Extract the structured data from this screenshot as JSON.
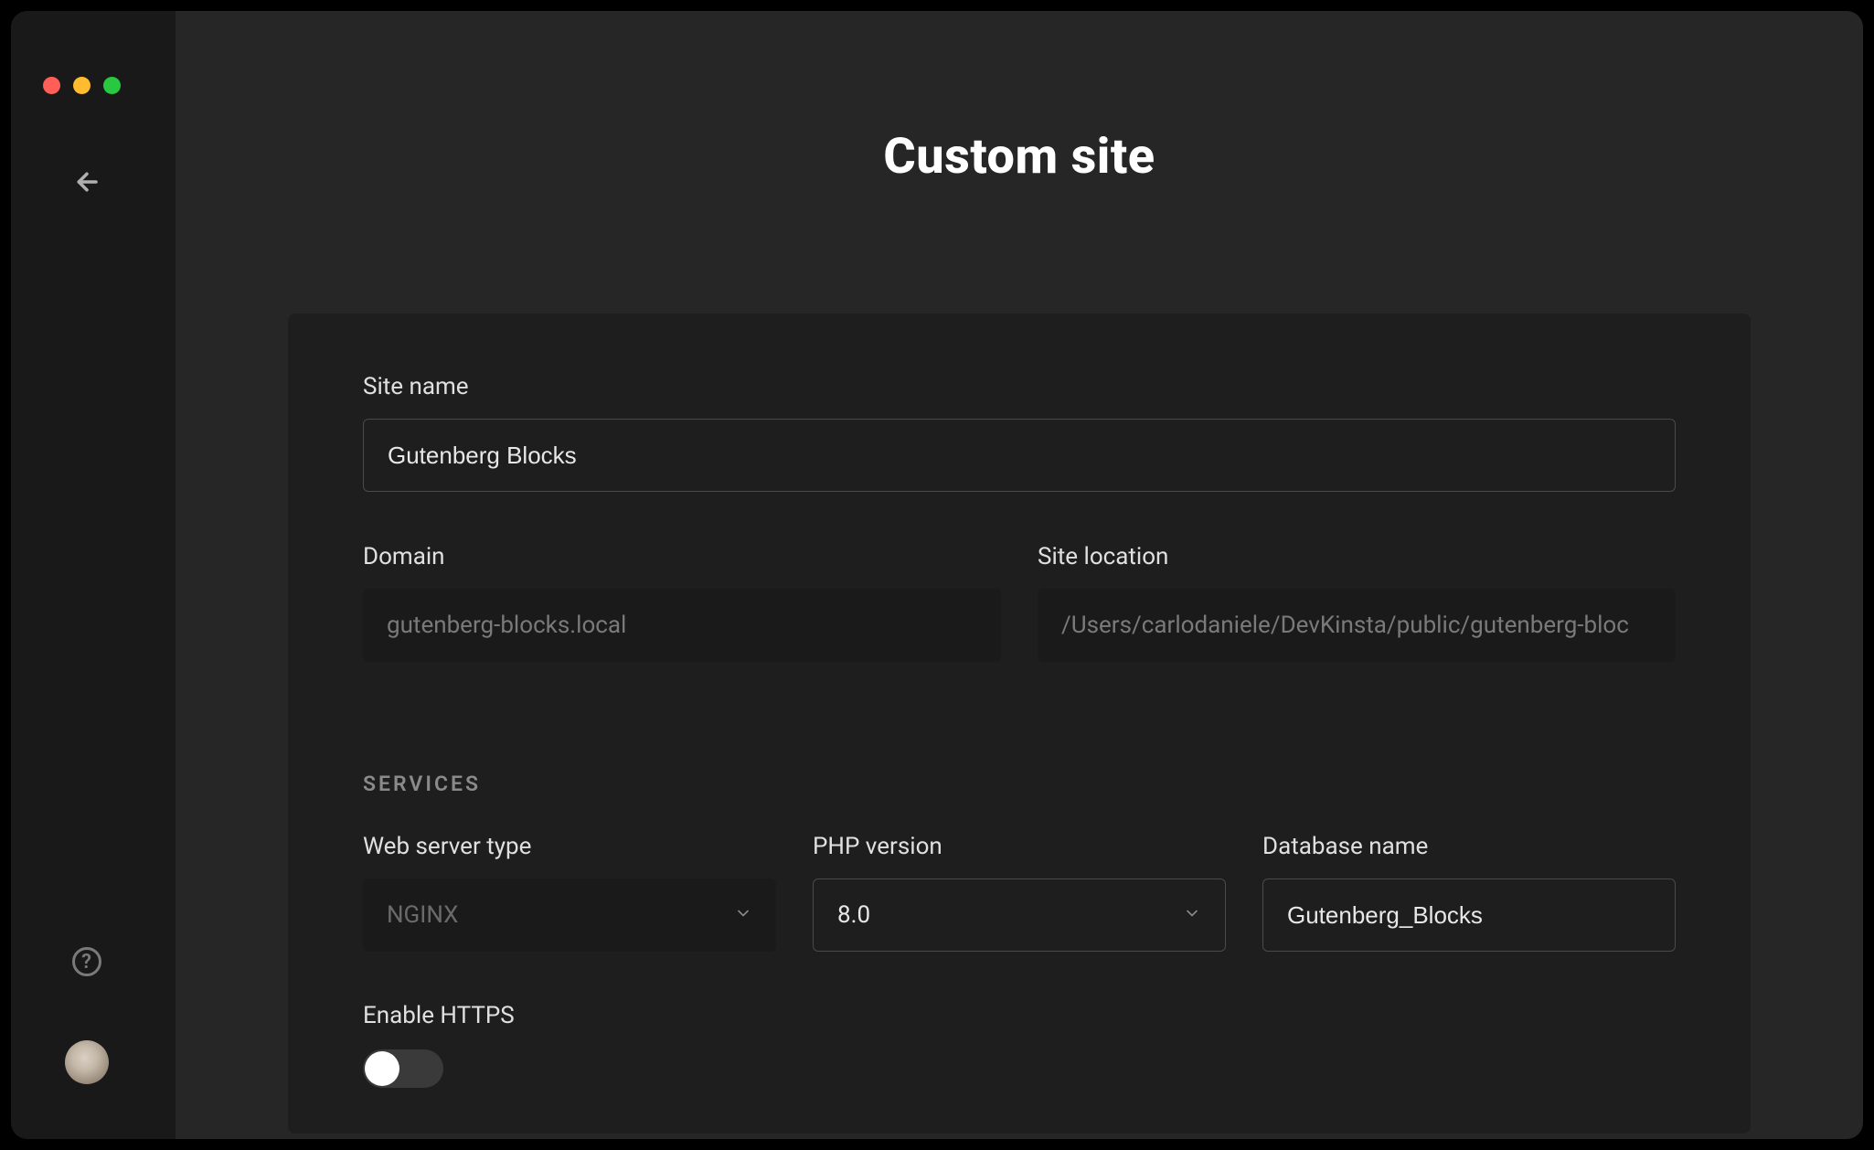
{
  "page": {
    "title": "Custom site"
  },
  "form": {
    "site_name": {
      "label": "Site name",
      "value": "Gutenberg Blocks"
    },
    "domain": {
      "label": "Domain",
      "value": "gutenberg-blocks.local"
    },
    "site_location": {
      "label": "Site location",
      "value": "/Users/carlodaniele/DevKinsta/public/gutenberg-bloc"
    },
    "services_label": "SERVICES",
    "web_server": {
      "label": "Web server type",
      "value": "NGINX"
    },
    "php_version": {
      "label": "PHP version",
      "value": "8.0"
    },
    "database_name": {
      "label": "Database name",
      "value": "Gutenberg_Blocks"
    },
    "enable_https": {
      "label": "Enable HTTPS",
      "value": false
    }
  },
  "sidebar": {
    "help_glyph": "?"
  }
}
